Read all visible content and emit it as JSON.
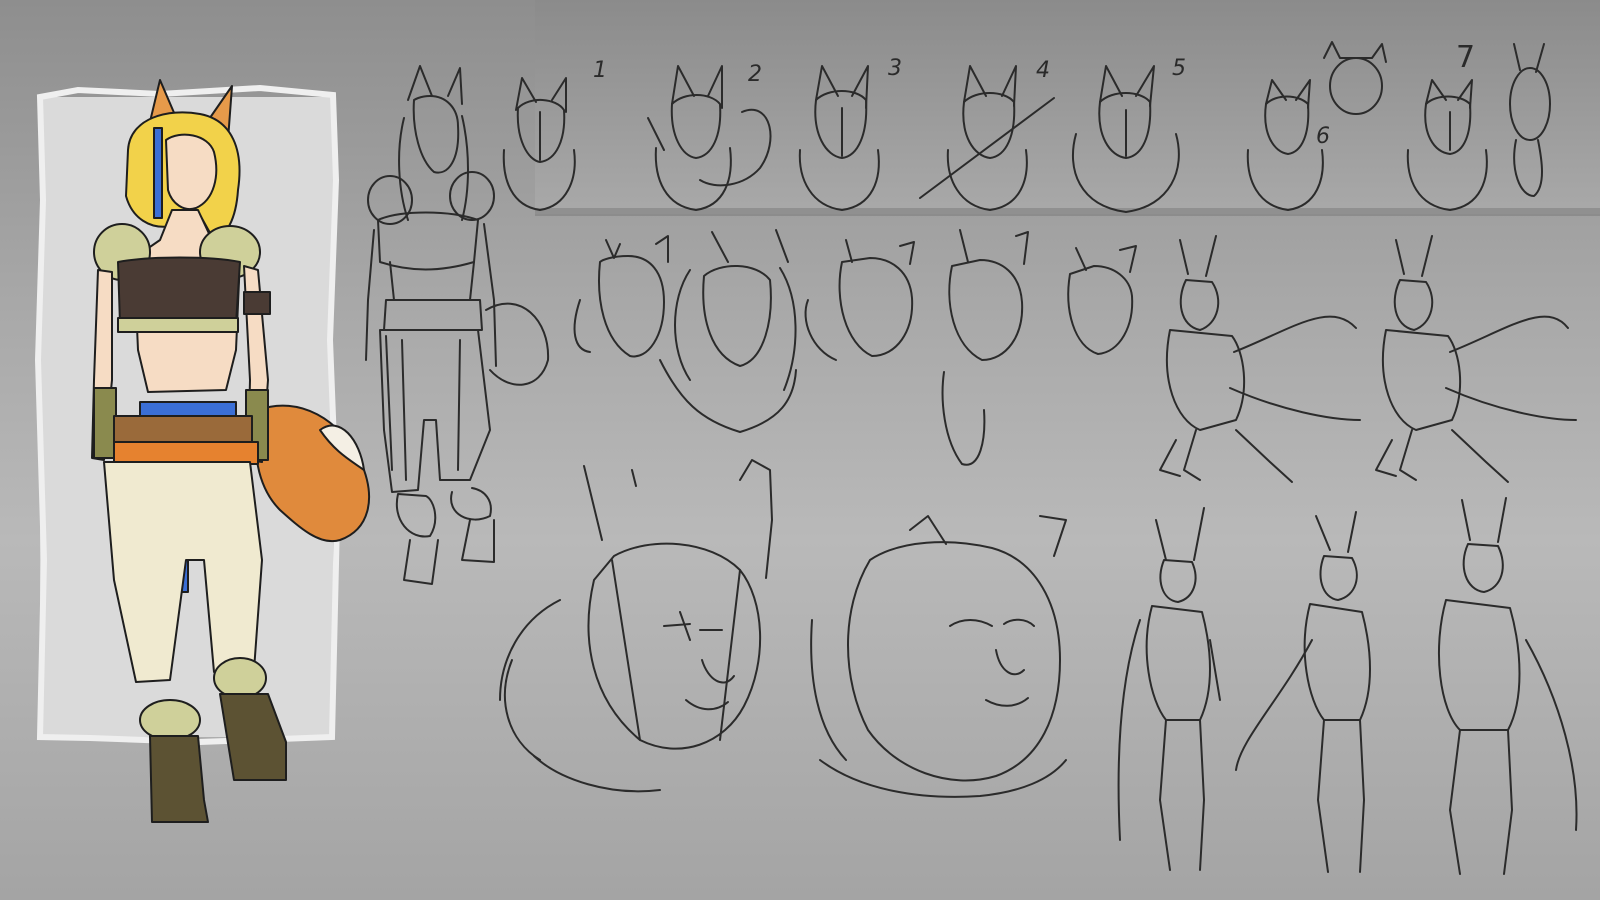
{
  "sheet": {
    "variant_numbers": [
      "1",
      "2",
      "3",
      "4",
      "5",
      "6",
      "7"
    ],
    "colors": {
      "background_top": "#8e8e8e",
      "background_mid": "#b9b9b9",
      "strip_band": "#a3a3a3",
      "card_paper": "#dadada",
      "sketch_line": "#2b2b2b",
      "hair": "#f2d24a",
      "fur_trim": "#cfd09a",
      "top": "#4a3b34",
      "tail": "#e08a3c",
      "pants": "#f0ead0",
      "belt": "#9a6a3a",
      "sash_orange": "#e6822f",
      "stripe_blue": "#3b6fd6",
      "boots": "#5c5233",
      "skin": "#f6dcc4"
    }
  }
}
